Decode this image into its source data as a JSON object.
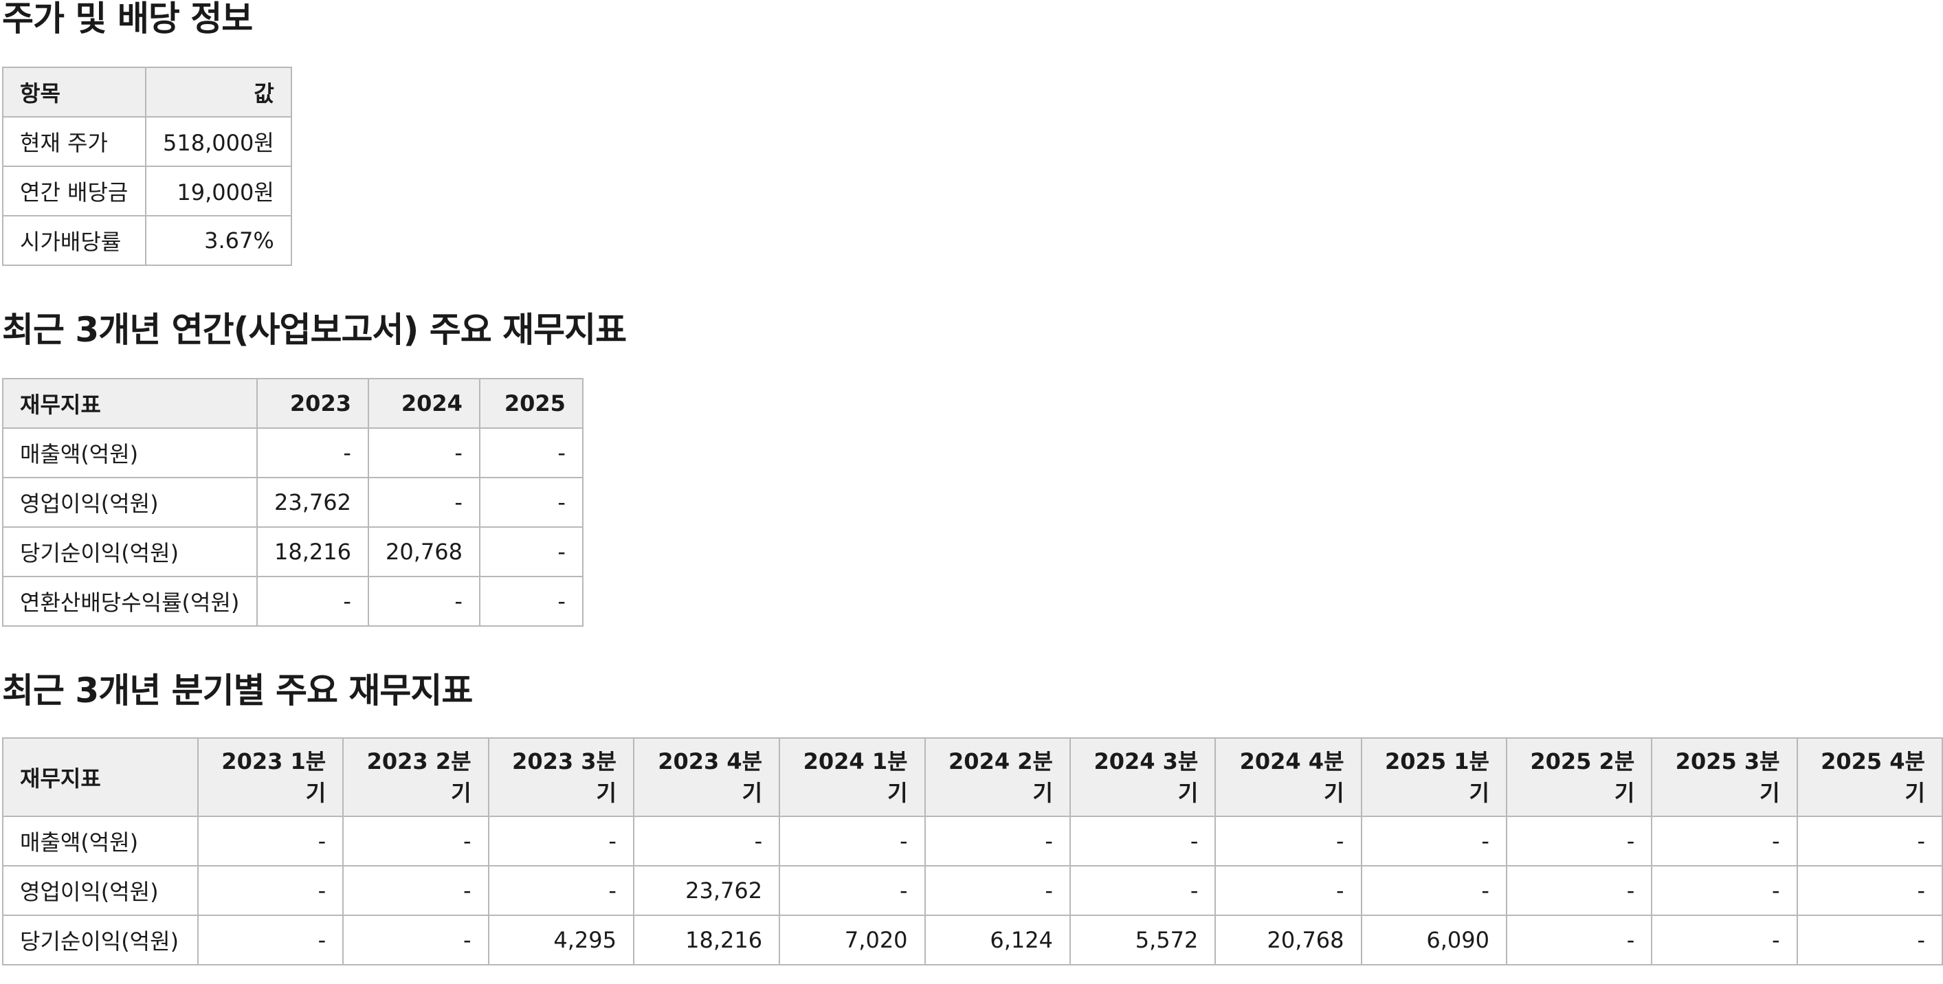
{
  "stock": {
    "title": "주가 및 배당 정보",
    "headers": [
      "항목",
      "값"
    ],
    "rows": [
      {
        "label": "현재 주가",
        "value": "518,000원"
      },
      {
        "label": "연간 배당금",
        "value": "19,000원"
      },
      {
        "label": "시가배당률",
        "value": "3.67%"
      }
    ]
  },
  "annual": {
    "title": "최근 3개년 연간(사업보고서) 주요 재무지표",
    "metric_header": "재무지표",
    "years": [
      "2023",
      "2024",
      "2025"
    ],
    "rows": [
      {
        "metric": "매출액(억원)",
        "values": [
          "-",
          "-",
          "-"
        ]
      },
      {
        "metric": "영업이익(억원)",
        "values": [
          "23,762",
          "-",
          "-"
        ]
      },
      {
        "metric": "당기순이익(억원)",
        "values": [
          "18,216",
          "20,768",
          "-"
        ]
      },
      {
        "metric": "연환산배당수익률(억원)",
        "values": [
          "-",
          "-",
          "-"
        ]
      }
    ]
  },
  "quarterly": {
    "title": "최근 3개년 분기별 주요 재무지표",
    "metric_header": "재무지표",
    "quarters": [
      "2023 1분기",
      "2023 2분기",
      "2023 3분기",
      "2023 4분기",
      "2024 1분기",
      "2024 2분기",
      "2024 3분기",
      "2024 4분기",
      "2025 1분기",
      "2025 2분기",
      "2025 3분기",
      "2025 4분기"
    ],
    "rows": [
      {
        "metric": "매출액(억원)",
        "values": [
          "-",
          "-",
          "-",
          "-",
          "-",
          "-",
          "-",
          "-",
          "-",
          "-",
          "-",
          "-"
        ]
      },
      {
        "metric": "영업이익(억원)",
        "values": [
          "-",
          "-",
          "-",
          "23,762",
          "-",
          "-",
          "-",
          "-",
          "-",
          "-",
          "-",
          "-"
        ]
      },
      {
        "metric": "당기순이익(억원)",
        "values": [
          "-",
          "-",
          "4,295",
          "18,216",
          "7,020",
          "6,124",
          "5,572",
          "20,768",
          "6,090",
          "-",
          "-",
          "-"
        ]
      }
    ]
  }
}
